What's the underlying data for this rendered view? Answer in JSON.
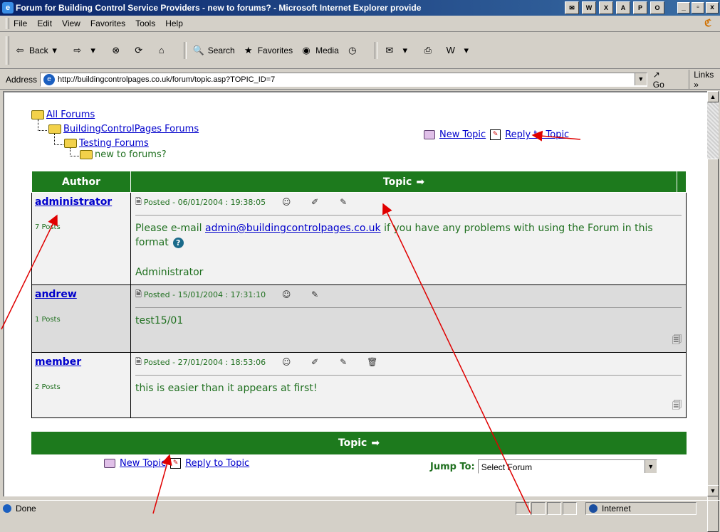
{
  "window": {
    "title": "Forum for Building Control Service Providers - new to forums? - Microsoft Internet Explorer provide",
    "controls": [
      "_",
      "▫",
      "x"
    ]
  },
  "menu": [
    "File",
    "Edit",
    "View",
    "Favorites",
    "Tools",
    "Help"
  ],
  "toolbar": {
    "back": "Back",
    "search": "Search",
    "favorites": "Favorites",
    "media": "Media"
  },
  "address": {
    "label": "Address",
    "url": "http://buildingcontrolpages.co.uk/forum/topic.asp?TOPIC_ID=7",
    "go": "Go",
    "links": "Links"
  },
  "breadcrumb": {
    "all_forums": "All Forums",
    "bcp_forums": "BuildingControlPages Forums",
    "testing_forums": "Testing Forums",
    "topic": "new to forums?"
  },
  "actions": {
    "new_topic": "New Topic",
    "reply_to_topic": "Reply to Topic"
  },
  "table": {
    "author_header": "Author",
    "topic_header": "Topic",
    "footer_label": "Topic"
  },
  "posts": [
    {
      "author": "administrator",
      "post_count": "7 Posts",
      "posted": "Posted - 06/01/2004 :  19:38:05",
      "message_pre": "Please e-mail ",
      "message_link": "admin@buildingcontrolpages.co.uk",
      "message_post": " if you have any problems with using the Forum in this format",
      "signature": "Administrator"
    },
    {
      "author": "andrew",
      "post_count": "1 Posts",
      "posted": "Posted - 15/01/2004 :  17:31:10",
      "message": "test15/01"
    },
    {
      "author": "member",
      "post_count": "2 Posts",
      "posted": "Posted - 27/01/2004 :  18:53:06",
      "message": "this is easier than it appears at first!"
    }
  ],
  "jump": {
    "label": "Jump To:",
    "selected": "Select Forum"
  },
  "status": {
    "text": "Done",
    "zone": "Internet"
  },
  "colors": {
    "header_green": "#1d7a1d",
    "text_green": "#207020",
    "link_blue": "#0000cc",
    "annotation_red": "#e00000"
  }
}
